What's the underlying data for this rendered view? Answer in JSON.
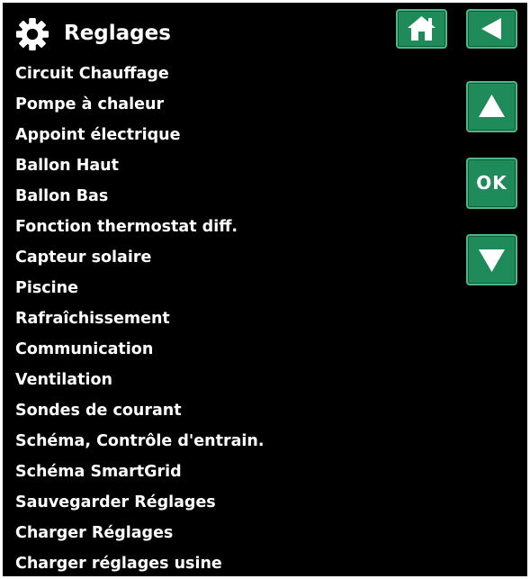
{
  "header": {
    "title": "Reglages",
    "gear_icon": "gear-icon",
    "home_icon": "home-icon",
    "back_icon": "back-arrow-icon"
  },
  "nav": {
    "up_icon": "up-arrow-icon",
    "ok_label": "OK",
    "down_icon": "down-arrow-icon"
  },
  "colors": {
    "background": "#000000",
    "text": "#ffffff",
    "button": "#1f8a5a",
    "button_border": "#4fb685"
  },
  "menu": {
    "items": [
      {
        "label": "Circuit Chauffage"
      },
      {
        "label": "Pompe à chaleur"
      },
      {
        "label": "Appoint électrique"
      },
      {
        "label": "Ballon Haut"
      },
      {
        "label": "Ballon Bas"
      },
      {
        "label": "Fonction thermostat diff."
      },
      {
        "label": "Capteur solaire"
      },
      {
        "label": "Piscine"
      },
      {
        "label": "Rafraîchissement"
      },
      {
        "label": "Communication"
      },
      {
        "label": "Ventilation"
      },
      {
        "label": "Sondes de courant"
      },
      {
        "label": "Schéma, Contrôle d'entrain."
      },
      {
        "label": "Schéma SmartGrid"
      },
      {
        "label": "Sauvegarder Réglages"
      },
      {
        "label": "Charger Réglages"
      },
      {
        "label": "Charger réglages usine"
      }
    ]
  }
}
